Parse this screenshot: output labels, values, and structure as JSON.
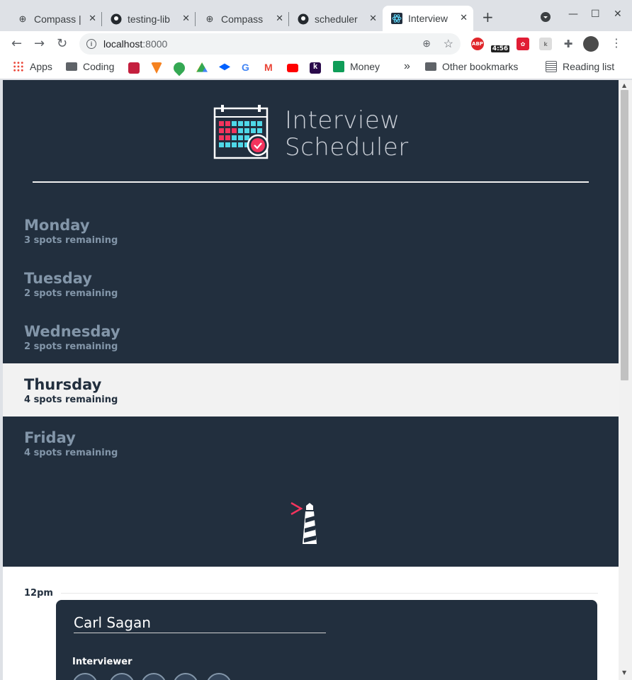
{
  "browser": {
    "tabs": [
      {
        "title": "Compass |",
        "icon": "compass-icon"
      },
      {
        "title": "testing-lib",
        "icon": "github-icon"
      },
      {
        "title": "Compass",
        "icon": "compass-icon"
      },
      {
        "title": "scheduler",
        "icon": "github-icon"
      },
      {
        "title": "Interview",
        "icon": "react-icon"
      }
    ],
    "url_host": "localhost",
    "url_port": ":8000",
    "ext_badge": "4:56",
    "ext_abp": "ABP",
    "bookmarks": [
      {
        "label": "Apps",
        "icon": "apps-grid-icon"
      },
      {
        "label": "Coding",
        "icon": "folder-icon"
      },
      {
        "label": "Money",
        "icon": "sheets-icon"
      }
    ],
    "other_bookmarks": "Other bookmarks",
    "reading_list": "Reading list",
    "overflow": "»"
  },
  "app": {
    "logo_line1": "Interview",
    "logo_line2": "Scheduler",
    "days": [
      {
        "name": "Monday",
        "spots": "3 spots remaining",
        "selected": false
      },
      {
        "name": "Tuesday",
        "spots": "2 spots remaining",
        "selected": false
      },
      {
        "name": "Wednesday",
        "spots": "2 spots remaining",
        "selected": false
      },
      {
        "name": "Thursday",
        "spots": "4 spots remaining",
        "selected": true
      },
      {
        "name": "Friday",
        "spots": "4 spots remaining",
        "selected": false
      }
    ],
    "appointment": {
      "time": "12pm",
      "student": "Carl Sagan",
      "interviewer_label": "Interviewer"
    }
  },
  "colors": {
    "sidebar_bg": "#222f3e",
    "day_text": "#8396a9",
    "selected_bg": "#f2f2f2",
    "accent": "#f3345d",
    "grid_cyan": "#4fd8e8"
  }
}
